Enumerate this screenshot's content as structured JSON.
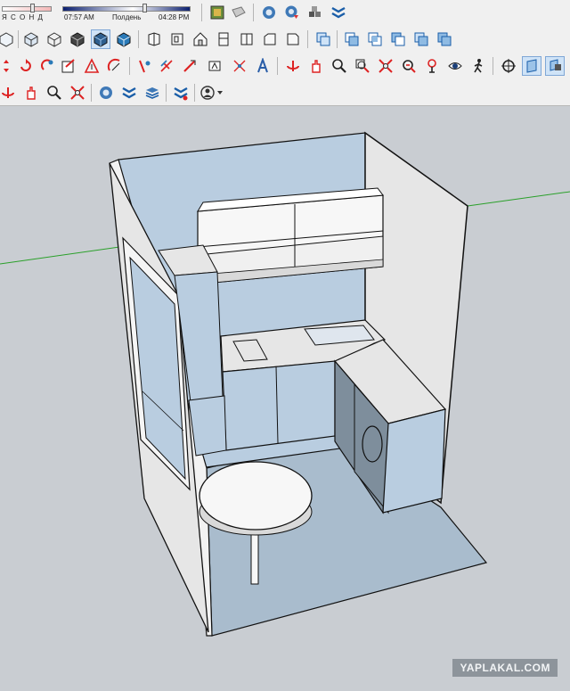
{
  "shadows": {
    "months_label": "Я С О Н Д",
    "start_time": "07:57 AM",
    "noon_label": "Полдень",
    "end_time": "04:28 PM"
  },
  "toolbar": {
    "row1": [
      "shadow-settings-icon",
      "styles-icon",
      "eraser-icon",
      "zoom-extents-icon",
      "zoom-window-icon",
      "components-icon",
      "sections-icon"
    ],
    "row2": [
      "iso-view-icon",
      "top-view-icon",
      "front-view-icon",
      "right-view-icon",
      "back-view-icon",
      "left-view-icon",
      "house-icon",
      "component-icon",
      "door-icon",
      "window-icon",
      "stair-icon",
      "union-icon",
      "subtract-icon",
      "intersect-icon",
      "trim-icon",
      "split-icon",
      "outer-shell-icon"
    ],
    "row3": [
      "move-icon",
      "rotate-icon",
      "scale-icon",
      "pushpull-icon",
      "followme-icon",
      "offset-icon",
      "tape-icon",
      "protractor-icon",
      "dimension-icon",
      "text-icon",
      "axes-icon",
      "3dtext-icon",
      "orbit-icon",
      "pan-icon",
      "zoom-icon",
      "zoom-extents-icon",
      "previous-view-icon",
      "position-camera-icon",
      "look-around-icon",
      "walk-icon",
      "section-plane-icon",
      "display-section-icon",
      "display-cuts-icon"
    ],
    "row4": [
      "orbit-icon",
      "pan-icon",
      "zoom-icon",
      "zoom-extents-icon",
      "warehouse-icon",
      "layers-icon",
      "model-info-icon",
      "extension-icon",
      "user-account-icon"
    ]
  },
  "colors": {
    "wall_light": "#b9cde0",
    "wall_gray": "#e6e6e6",
    "floor": "#a9bccd",
    "cabinet_white": "#f7f7f7",
    "appliance_dark": "#7e8e9c",
    "edge": "#111111",
    "axis_green": "#2aa02a"
  },
  "watermark": "YAPLAKAL.COM"
}
